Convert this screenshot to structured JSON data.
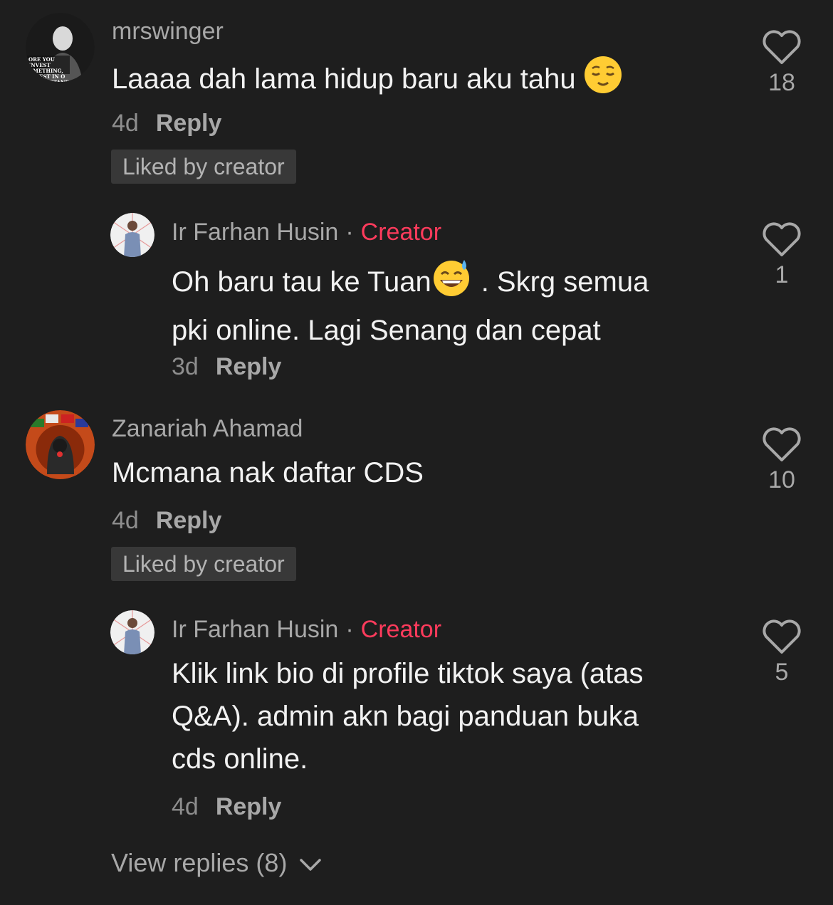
{
  "comments": [
    {
      "username": "mrswinger",
      "text": "Laaaa dah lama hidup baru aku tahu",
      "time": "4d",
      "reply_label": "Reply",
      "badge": "Liked by creator",
      "likes": "18",
      "avatar_caption": "ORE YOU INVEST OMETHING, INVEST IN O UNDERSTAND IT."
    },
    {
      "username": "Ir Farhan Husin",
      "creator_label": "Creator",
      "dot": "·",
      "text_line1": "Oh baru tau ke Tuan",
      "text_line1b": ". Skrg semua",
      "text_line2": "pki online. Lagi Senang dan cepat",
      "time": "3d",
      "reply_label": "Reply",
      "likes": "1"
    },
    {
      "username": "Zanariah Ahamad",
      "text": "Mcmana nak daftar CDS",
      "time": "4d",
      "reply_label": "Reply",
      "badge": "Liked by creator",
      "likes": "10"
    },
    {
      "username": "Ir Farhan Husin",
      "creator_label": "Creator",
      "dot": "·",
      "text_line1": "Klik link bio di profile tiktok saya (atas",
      "text_line2": "Q&A). admin akn bagi panduan buka",
      "text_line3": "cds online.",
      "time": "4d",
      "reply_label": "Reply",
      "likes": "5"
    }
  ],
  "view_replies": "View replies (8)",
  "colors": {
    "background": "#1e1e1e",
    "creator": "#ff3b5c",
    "muted": "#a8a8a8"
  },
  "icons": [
    "heart-outline-icon",
    "chevron-down-icon",
    "relieved-face-emoji",
    "sweat-smile-emoji"
  ]
}
